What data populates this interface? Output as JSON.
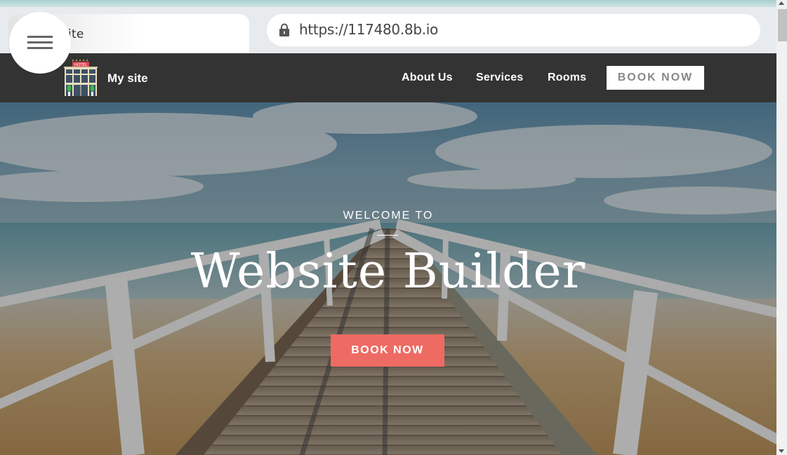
{
  "browser": {
    "tab_title_partial": "site",
    "url": "https://117480.8b.io",
    "icons": {
      "lock": "lock-icon",
      "menu": "hamburger-menu-icon"
    }
  },
  "navbar": {
    "site_name": "My site",
    "logo_icon": "hotel-building-icon",
    "logo_sign": "HOTEL",
    "links": [
      {
        "label": "About Us"
      },
      {
        "label": "Services"
      },
      {
        "label": "Rooms"
      }
    ],
    "cta_label": "BOOK NOW"
  },
  "hero": {
    "eyebrow": "WELCOME TO",
    "title": "Website Builder",
    "cta_label": "BOOK NOW",
    "background": "pier-over-beach-photo"
  },
  "colors": {
    "navbar_bg": "#333333",
    "accent_button": "#ee6b63",
    "nav_button_text": "#888888"
  }
}
